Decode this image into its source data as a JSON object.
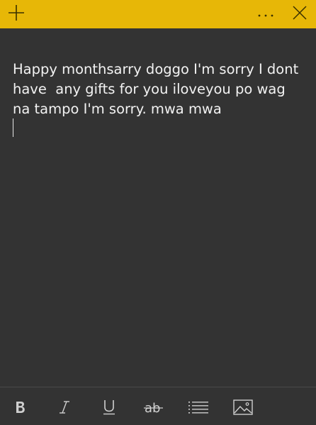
{
  "titlebar": {
    "color": "#e7b707",
    "buttons": [
      {
        "name": "add-note",
        "icon": "plus-icon"
      },
      {
        "name": "menu",
        "icon": "ellipsis-icon"
      },
      {
        "name": "close",
        "icon": "close-icon"
      }
    ]
  },
  "note": {
    "text": "Happy monthsarry doggo I'm sorry I dont have  any gifts for you iloveyou po wag na tampo I'm sorry. mwa mwa"
  },
  "toolbar": {
    "buttons": [
      {
        "name": "bold",
        "icon": "bold-icon"
      },
      {
        "name": "italic",
        "icon": "italic-icon"
      },
      {
        "name": "underline",
        "icon": "underline-icon"
      },
      {
        "name": "strikethrough",
        "icon": "strikethrough-icon"
      },
      {
        "name": "bullet-list",
        "icon": "list-icon"
      },
      {
        "name": "insert-image",
        "icon": "image-icon"
      }
    ]
  }
}
